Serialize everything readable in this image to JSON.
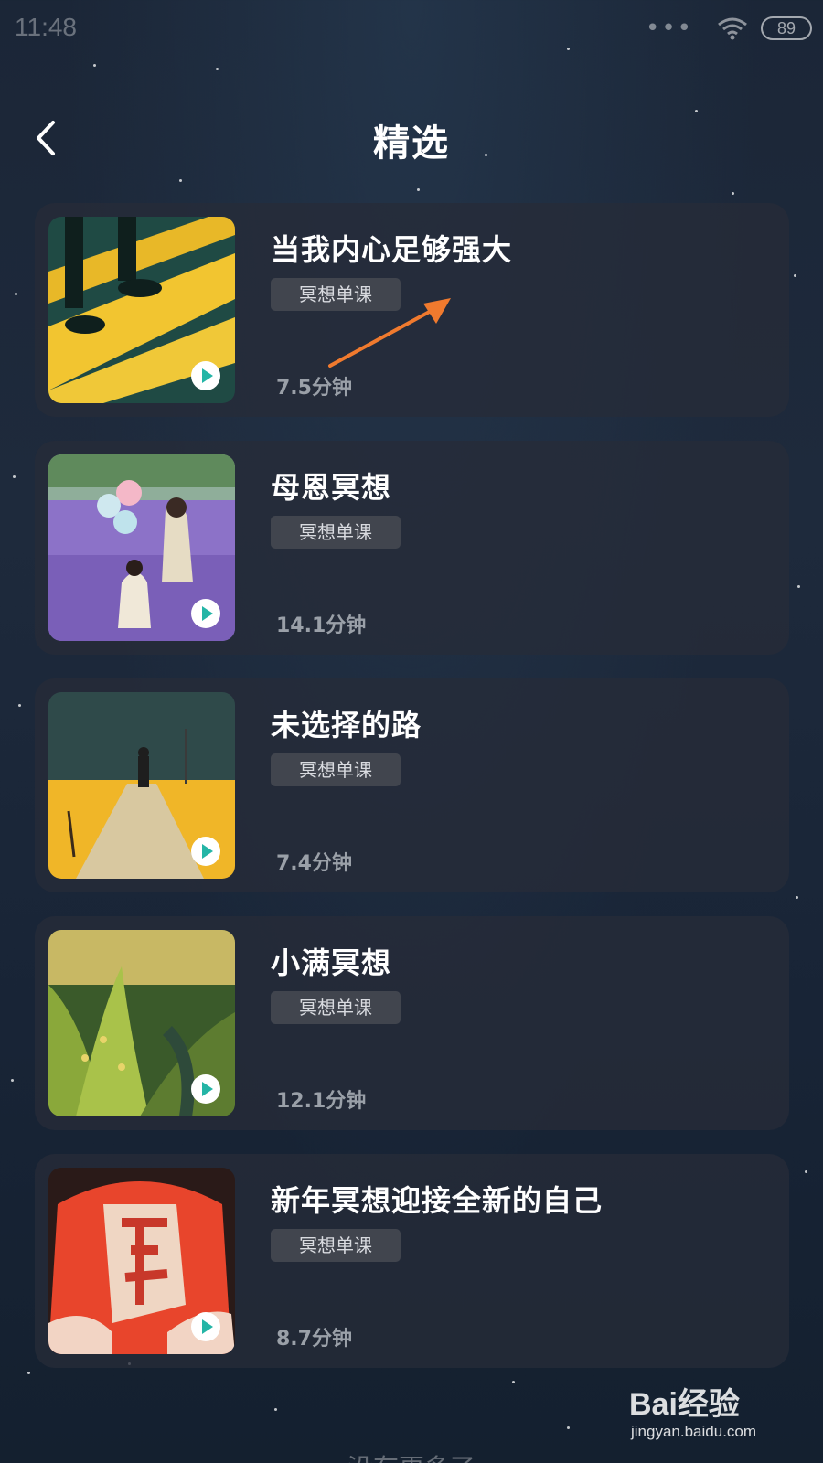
{
  "status_bar": {
    "time": "11:48",
    "signal_dots": "•••",
    "battery": "89"
  },
  "header": {
    "title": "精选",
    "back_icon": "chevron-left-icon"
  },
  "courses": [
    {
      "title": "当我内心足够强大",
      "tag": "冥想单课",
      "duration": "7.5分钟",
      "thumbnail": "yellow-crosswalk-feet"
    },
    {
      "title": "母恩冥想",
      "tag": "冥想单课",
      "duration": "14.1分钟",
      "thumbnail": "lavender-field-mother-child"
    },
    {
      "title": "未选择的路",
      "tag": "冥想单课",
      "duration": "7.4分钟",
      "thumbnail": "man-on-path-yellow-field"
    },
    {
      "title": "小满冥想",
      "tag": "冥想单课",
      "duration": "12.1分钟",
      "thumbnail": "green-rice-field"
    },
    {
      "title": "新年冥想迎接全新的自己",
      "tag": "冥想单课",
      "duration": "8.7分钟",
      "thumbnail": "red-fu-character"
    }
  ],
  "footer": {
    "end_text": "没有更多了"
  },
  "watermark": {
    "brand": "Bai经验",
    "site": "jingyan.baidu.com"
  },
  "colors": {
    "play_accent": "#24b5a6",
    "annotation_arrow": "#f07a2e"
  }
}
